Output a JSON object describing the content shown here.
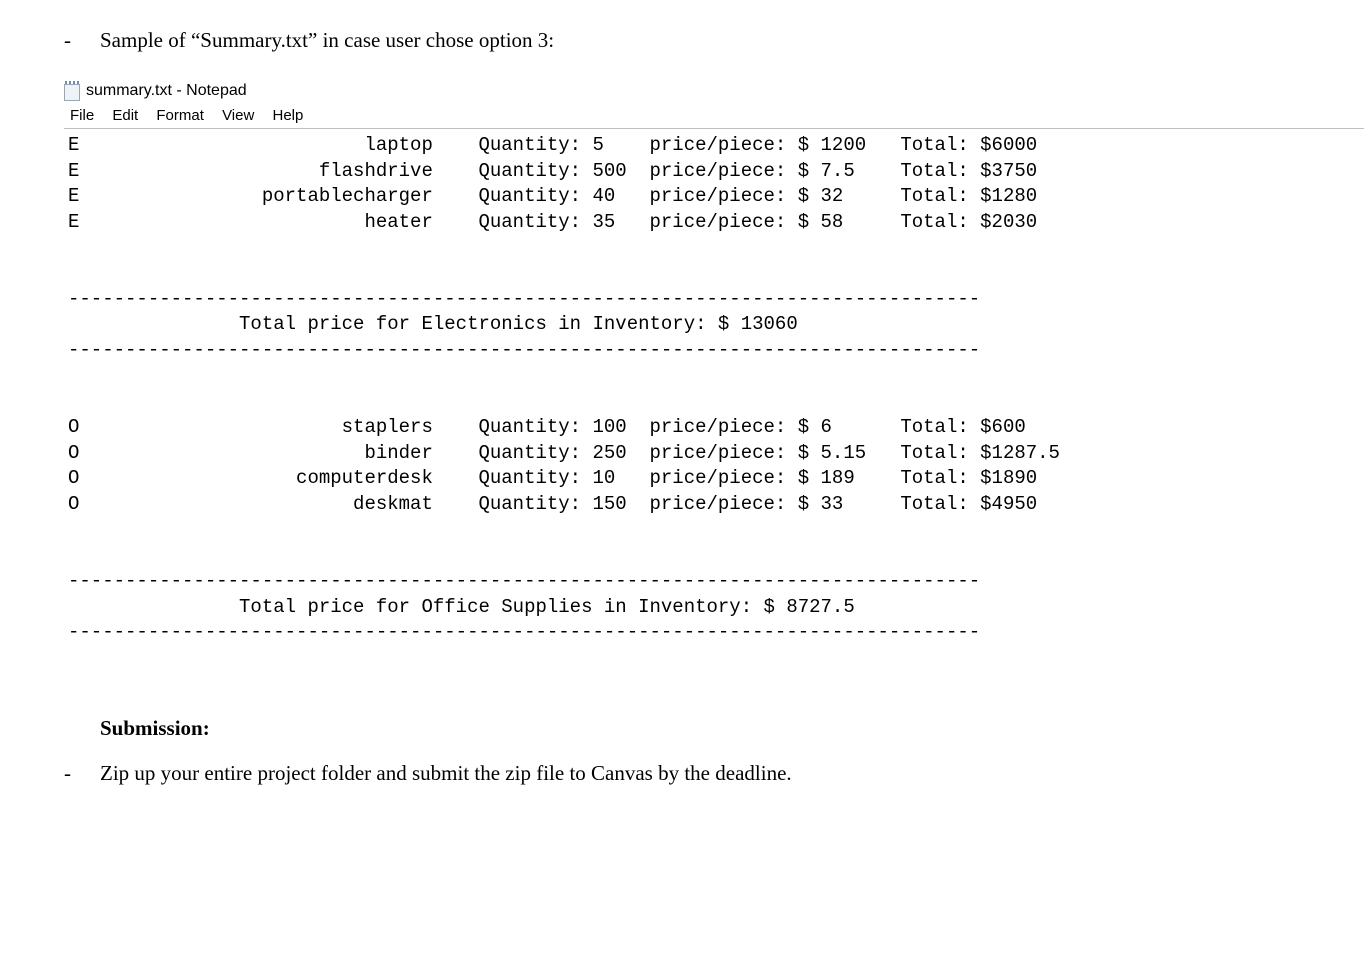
{
  "intro": {
    "bullet": "-",
    "text": "Sample of “Summary.txt” in case user chose option 3:"
  },
  "notepad": {
    "title": "summary.txt - Notepad",
    "menu": {
      "file": "File",
      "edit": "Edit",
      "format": "Format",
      "view": "View",
      "help": "Help"
    },
    "separator": "--------------------------------------------------------------------------------",
    "sections": [
      {
        "code": "E",
        "items": [
          {
            "name": "laptop",
            "qty": 5,
            "price": 1200,
            "total": 6000
          },
          {
            "name": "flashdrive",
            "qty": 500,
            "price": 7.5,
            "total": 3750
          },
          {
            "name": "portablecharger",
            "qty": 40,
            "price": 32,
            "total": 1280
          },
          {
            "name": "heater",
            "qty": 35,
            "price": 58,
            "total": 2030
          }
        ],
        "summary_label": "Total price for Electronics in Inventory: $ ",
        "summary_value": 13060
      },
      {
        "code": "O",
        "items": [
          {
            "name": "staplers",
            "qty": 100,
            "price": 6,
            "total": 600
          },
          {
            "name": "binder",
            "qty": 250,
            "price": 5.15,
            "total": 1287.5
          },
          {
            "name": "computerdesk",
            "qty": 10,
            "price": 189,
            "total": 1890
          },
          {
            "name": "deskmat",
            "qty": 150,
            "price": 33,
            "total": 4950
          }
        ],
        "summary_label": "Total price for Office Supplies in Inventory: $ ",
        "summary_value": 8727.5
      }
    ],
    "labels": {
      "qty": "Quantity: ",
      "price": "price/piece: $ ",
      "total": "Total: $"
    }
  },
  "submission": {
    "heading": "Submission:",
    "bullet": "-",
    "text": "Zip up your entire project folder and submit the zip file to Canvas by the deadline."
  }
}
